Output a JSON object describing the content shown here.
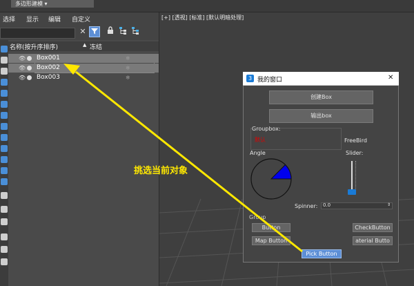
{
  "topbar": {
    "ribbon_tab": "多边形建模 ▾"
  },
  "menu": {
    "items": [
      "选择",
      "显示",
      "编辑",
      "自定义"
    ]
  },
  "scene_explorer": {
    "col_name": "名称(按升序排序)",
    "col_sort_icon": "▲",
    "col_frozen": "冻结",
    "objects": [
      "Box001",
      "Box002",
      "Box003"
    ]
  },
  "viewport": {
    "label": "[+] [透视] [标准] [默认明暗处理]"
  },
  "dialog": {
    "icon_text": "3",
    "title": "我的窗口",
    "close": "✕",
    "create_button": "创建Box",
    "output_button": "输出box",
    "groupbox_label": "Groupbox:",
    "groupbox_value": "默认",
    "freebird": "FreeBird",
    "angle_label": "Angle",
    "slider_label": "Slider:",
    "spinner_label": "Spinner:",
    "spinner_value": "0.0",
    "group_label": "Group",
    "button": "Button",
    "checkbutton": "CheckButton",
    "map_button": "Map Button",
    "material_button": "aterial Butto",
    "pick_button": "Pick Button"
  },
  "annotation": "挑选当前对象",
  "colors": {
    "annotation": "#ffe800",
    "pick_button": "#5d8fd6",
    "angle_fill": "#0000ee",
    "slider": "#1a7bd6"
  }
}
